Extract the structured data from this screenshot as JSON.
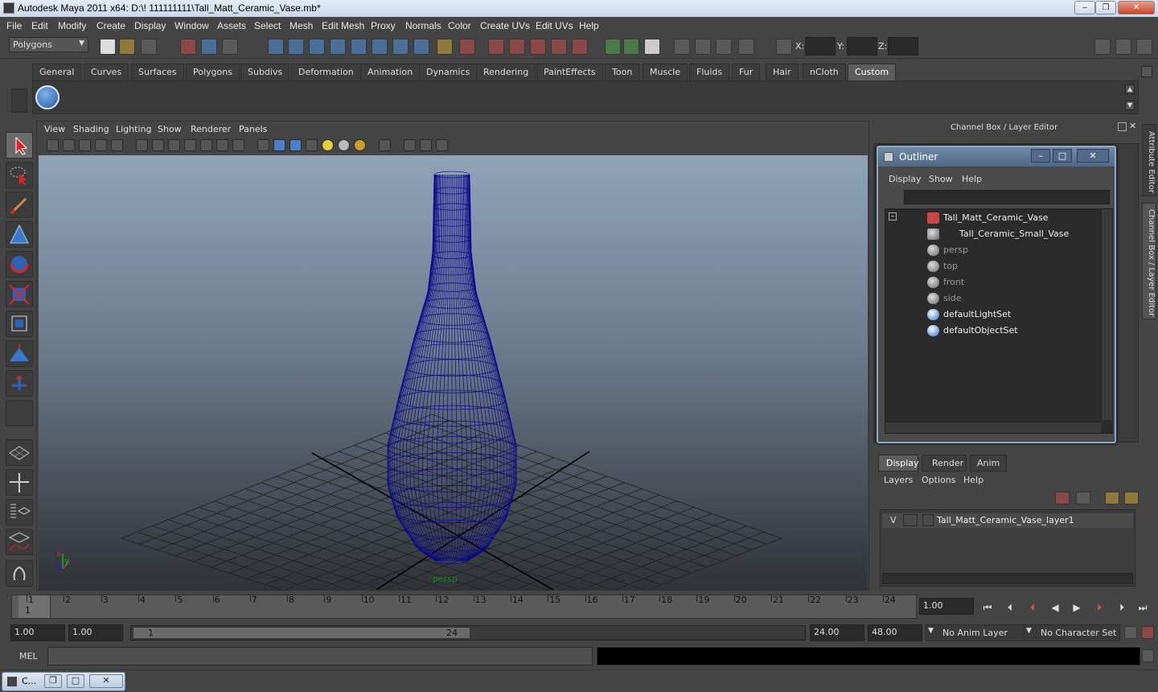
{
  "window": {
    "title": "Autodesk Maya 2011 x64: D:\\! 111111111\\Tall_Matt_Ceramic_Vase.mb*",
    "buttons": [
      "–",
      "❐",
      "✕"
    ]
  },
  "menubar": [
    "File",
    "Edit",
    "Modify",
    "Create",
    "Display",
    "Window",
    "Assets",
    "Select",
    "Mesh",
    "Edit Mesh",
    "Proxy",
    "Normals",
    "Color",
    "Create UVs",
    "Edit UVs",
    "Help"
  ],
  "statusline": {
    "mode": "Polygons",
    "x_label": "X:",
    "y_label": "Y:",
    "z_label": "Z:"
  },
  "shelf": {
    "tabs": [
      "General",
      "Curves",
      "Surfaces",
      "Polygons",
      "Subdivs",
      "Deformation",
      "Animation",
      "Dynamics",
      "Rendering",
      "PaintEffects",
      "Toon",
      "Muscle",
      "Fluids",
      "Fur",
      "Hair",
      "nCloth",
      "Custom"
    ],
    "active_tab": "Custom"
  },
  "viewport": {
    "menus": [
      "View",
      "Shading",
      "Lighting",
      "Show",
      "Renderer",
      "Panels"
    ],
    "camera_label": "persp",
    "axis_x": "x",
    "axis_y": "y",
    "wire_color": "#0a0a8c"
  },
  "channel_box_title": "Channel Box / Layer Editor",
  "side_tabs": [
    "Attribute Editor",
    "Channel Box / Layer Editor"
  ],
  "outliner": {
    "title": "Outliner",
    "menus": [
      "Display",
      "Show",
      "Help"
    ],
    "items": [
      {
        "label": "Tall_Matt_Ceramic_Vase",
        "dim": false
      },
      {
        "label": "Tall_Ceramic_Small_Vase",
        "dim": false
      },
      {
        "label": "persp",
        "dim": true
      },
      {
        "label": "top",
        "dim": true
      },
      {
        "label": "front",
        "dim": true
      },
      {
        "label": "side",
        "dim": true
      },
      {
        "label": "defaultLightSet",
        "dim": false
      },
      {
        "label": "defaultObjectSet",
        "dim": false
      }
    ]
  },
  "layer_editor": {
    "tabs": [
      "Display",
      "Render",
      "Anim"
    ],
    "active_tab": "Display",
    "menus": [
      "Layers",
      "Options",
      "Help"
    ],
    "layer_visibility": "V",
    "layer_name": "Tall_Matt_Ceramic_Vase_layer1"
  },
  "time_slider": {
    "frames": [
      "1",
      "2",
      "3",
      "4",
      "5",
      "6",
      "7",
      "8",
      "9",
      "10",
      "11",
      "12",
      "13",
      "14",
      "15",
      "16",
      "17",
      "18",
      "19",
      "20",
      "21",
      "22",
      "23",
      "24"
    ],
    "current_frame_marker": "1",
    "current_time": "1.00"
  },
  "range_slider": {
    "start_time": "1.00",
    "playback_start": "1.00",
    "range_start_label": "1",
    "range_end_label": "24",
    "playback_end": "24.00",
    "end_time": "48.00",
    "anim_layer": "No Anim Layer",
    "character_set": "No Character Set"
  },
  "command_line": {
    "label": "MEL"
  },
  "taskbar": {
    "item_label": "C..."
  }
}
